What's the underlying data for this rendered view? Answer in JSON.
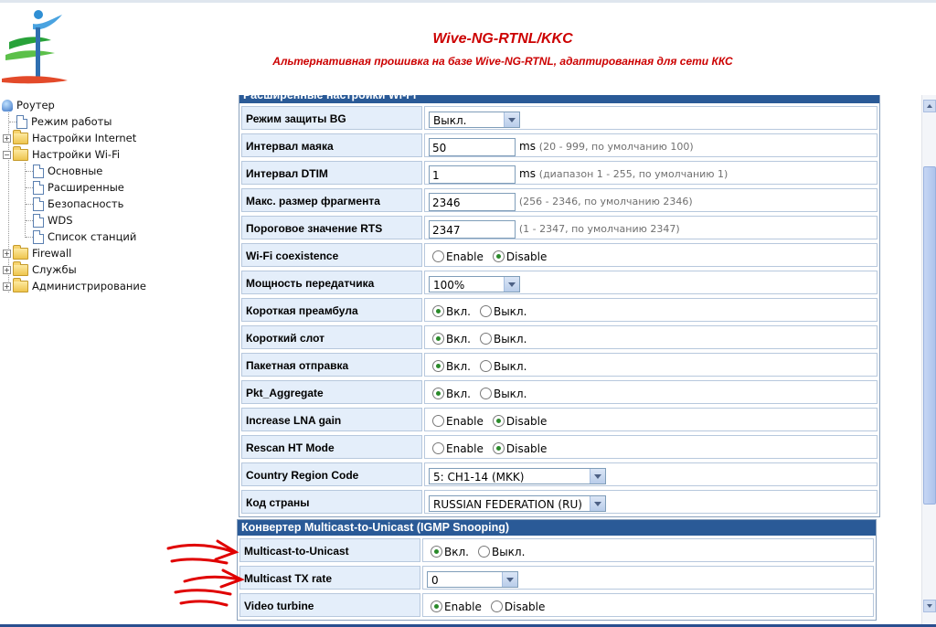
{
  "header": {
    "title": "Wive-NG-RTNL/KKC",
    "subtitle": "Альтернативная прошивка на базе Wive-NG-RTNL, адаптированная для сети ККС"
  },
  "tree": {
    "root": "Роутер",
    "items": [
      {
        "label": "Режим работы"
      },
      {
        "label": "Настройки Internet"
      },
      {
        "label": "Настройки Wi-Fi"
      },
      {
        "label": "Основные"
      },
      {
        "label": "Расширенные"
      },
      {
        "label": "Безопасность"
      },
      {
        "label": "WDS"
      },
      {
        "label": "Список станций"
      },
      {
        "label": "Firewall"
      },
      {
        "label": "Службы"
      },
      {
        "label": "Администрирование"
      }
    ]
  },
  "wifi_panel": {
    "title": "Расширенные настройки Wi-Fi",
    "rows": [
      {
        "label": "Режим защиты BG",
        "value": "Выкл."
      },
      {
        "label": "Интервал маяка",
        "value": "50",
        "unit": "ms",
        "hint": "(20 - 999, по умолчанию 100)"
      },
      {
        "label": "Интервал DTIM",
        "value": "1",
        "unit": "ms",
        "hint": "(диапазон 1 - 255, по умолчанию 1)"
      },
      {
        "label": "Макс. размер фрагмента",
        "value": "2346",
        "hint": "(256 - 2346, по умолчанию 2346)"
      },
      {
        "label": "Пороговое значение RTS",
        "value": "2347",
        "hint": "(1 - 2347, по умолчанию 2347)"
      },
      {
        "label": "Wi-Fi coexistence",
        "opt1": "Enable",
        "opt2": "Disable"
      },
      {
        "label": "Мощность передатчика",
        "value": "100%"
      },
      {
        "label": "Короткая преамбула",
        "opt1": "Вкл.",
        "opt2": "Выкл."
      },
      {
        "label": "Короткий слот",
        "opt1": "Вкл.",
        "opt2": "Выкл."
      },
      {
        "label": "Пакетная отправка",
        "opt1": "Вкл.",
        "opt2": "Выкл."
      },
      {
        "label": "Pkt_Aggregate",
        "opt1": "Вкл.",
        "opt2": "Выкл."
      },
      {
        "label": "Increase LNA gain",
        "opt1": "Enable",
        "opt2": "Disable"
      },
      {
        "label": "Rescan HT Mode",
        "opt1": "Enable",
        "opt2": "Disable"
      },
      {
        "label": "Country Region Code",
        "value": "5: CH1-14 (MKK)"
      },
      {
        "label": "Код страны",
        "value": "RUSSIAN FEDERATION (RU)"
      }
    ]
  },
  "igmp_panel": {
    "title": "Конвертер Multicast-to-Unicast (IGMP Snooping)",
    "rows": [
      {
        "label": "Multicast-to-Unicast",
        "opt1": "Вкл.",
        "opt2": "Выкл."
      },
      {
        "label": "Multicast TX rate",
        "value": "0"
      },
      {
        "label": "Video turbine",
        "opt1": "Enable",
        "opt2": "Disable"
      }
    ]
  },
  "colors": {
    "header_red": "#cc0000",
    "panel_header": "#2a5a97",
    "label_bg": "#e4eefa",
    "annotation": "#e00000"
  }
}
